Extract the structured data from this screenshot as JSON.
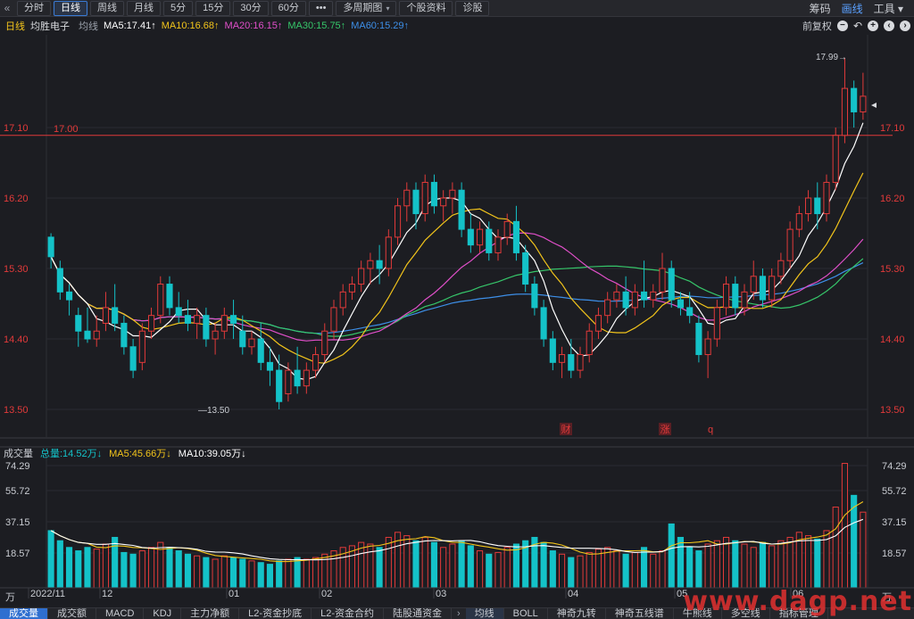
{
  "toolbar": {
    "back_icon": "«",
    "buttons": [
      "分时",
      "日线",
      "周线",
      "月线",
      "5分",
      "15分",
      "30分",
      "60分",
      "•••",
      "多周期图",
      "个股资料",
      "诊股"
    ],
    "active_index": 1,
    "right": [
      "筹码",
      "画线",
      "工具"
    ]
  },
  "info": {
    "period": "日线",
    "name": "均胜电子",
    "line_type": "均线",
    "ma5": "MA5:17.41↑",
    "ma10": "MA10:16.68↑",
    "ma20": "MA20:16.15↑",
    "ma30": "MA30:15.75↑",
    "ma60": "MA60:15.29↑",
    "adjust": "前复权"
  },
  "price_axis": [
    "17.10",
    "16.20",
    "15.30",
    "14.40",
    "13.50"
  ],
  "price_line_label": "17.00",
  "high_label": "17.99→",
  "low_label": "—13.50",
  "markers": [
    "财",
    "涨",
    "q"
  ],
  "volume_info": {
    "label": "成交量",
    "total": "总量:14.52万↓",
    "ma5": "MA5:45.66万↓",
    "ma10": "MA10:39.05万↓"
  },
  "volume_axis": [
    "74.29",
    "55.72",
    "37.15",
    "18.57",
    "万"
  ],
  "dates": [
    "2022/11",
    "12",
    "01",
    "02",
    "03",
    "04",
    "05",
    "06"
  ],
  "tabs": [
    "成交量",
    "成交额",
    "MACD",
    "KDJ",
    "主力净额",
    "L2-资金抄底",
    "L2-资金合约",
    "陆股通资金",
    "均线",
    "BOLL",
    "神奇九转",
    "神奇五线谱",
    "牛熊线",
    "多空线",
    "指标管理"
  ],
  "tabs_active": 0,
  "tabs_blue": 8,
  "tabs_nav": "›",
  "watermark": "www.dagp.net",
  "colors": {
    "up": "#e23a3a",
    "down": "#14c2c8",
    "ma5": "#ffffff",
    "ma10": "#f2c41b",
    "ma20": "#e04fc9",
    "ma30": "#36c66a",
    "ma60": "#3d8fe8",
    "price_line": "#e03a3a"
  },
  "chart_data": {
    "type": "candlestick",
    "title": "均胜电子 日线",
    "ylim": [
      13.5,
      17.99
    ],
    "ma_values": {
      "MA5": 17.41,
      "MA10": 16.68,
      "MA20": 16.15,
      "MA30": 15.75,
      "MA60": 15.29
    },
    "candles": [
      [
        15.7,
        15.75,
        15.45,
        15.3
      ],
      [
        15.3,
        15.4,
        15.0,
        14.9
      ],
      [
        15.0,
        15.1,
        14.9,
        14.7
      ],
      [
        14.7,
        14.8,
        14.5,
        14.3
      ],
      [
        14.5,
        14.8,
        14.4,
        14.35
      ],
      [
        14.4,
        14.7,
        14.5,
        14.3
      ],
      [
        14.6,
        15.0,
        14.8,
        14.5
      ],
      [
        14.8,
        15.1,
        14.6,
        14.5
      ],
      [
        14.6,
        14.7,
        14.3,
        14.2
      ],
      [
        14.3,
        14.4,
        14.0,
        13.9
      ],
      [
        14.1,
        14.6,
        14.5,
        14.0
      ],
      [
        14.5,
        14.8,
        14.7,
        14.4
      ],
      [
        14.7,
        15.2,
        15.1,
        14.6
      ],
      [
        15.1,
        15.2,
        14.8,
        14.7
      ],
      [
        14.8,
        15.0,
        14.7,
        14.6
      ],
      [
        14.7,
        14.9,
        14.6,
        14.5
      ],
      [
        14.6,
        14.8,
        14.7,
        14.4
      ],
      [
        14.7,
        14.8,
        14.4,
        14.3
      ],
      [
        14.4,
        14.6,
        14.5,
        14.2
      ],
      [
        14.5,
        14.8,
        14.7,
        14.4
      ],
      [
        14.7,
        14.9,
        14.6,
        14.4
      ],
      [
        14.5,
        14.7,
        14.3,
        14.2
      ],
      [
        14.3,
        14.5,
        14.4,
        14.2
      ],
      [
        14.4,
        14.6,
        14.1,
        14.0
      ],
      [
        14.1,
        14.3,
        14.0,
        13.8
      ],
      [
        14.0,
        14.2,
        13.6,
        13.5
      ],
      [
        13.7,
        14.1,
        14.0,
        13.6
      ],
      [
        14.0,
        14.3,
        13.8,
        13.7
      ],
      [
        13.8,
        14.1,
        14.0,
        13.7
      ],
      [
        14.0,
        14.3,
        14.2,
        13.9
      ],
      [
        14.2,
        14.6,
        14.5,
        14.1
      ],
      [
        14.5,
        14.9,
        14.8,
        14.4
      ],
      [
        14.8,
        15.1,
        15.0,
        14.7
      ],
      [
        15.0,
        15.2,
        15.1,
        14.9
      ],
      [
        15.1,
        15.4,
        15.3,
        15.0
      ],
      [
        15.3,
        15.5,
        15.4,
        15.1
      ],
      [
        15.4,
        15.6,
        15.3,
        15.1
      ],
      [
        15.3,
        15.8,
        15.7,
        15.2
      ],
      [
        15.7,
        16.2,
        16.1,
        15.6
      ],
      [
        16.1,
        16.4,
        16.3,
        15.9
      ],
      [
        16.3,
        16.4,
        16.0,
        15.8
      ],
      [
        16.0,
        16.5,
        16.4,
        15.9
      ],
      [
        16.4,
        16.5,
        16.1,
        16.0
      ],
      [
        16.1,
        16.3,
        16.2,
        15.9
      ],
      [
        16.2,
        16.4,
        16.3,
        16.0
      ],
      [
        16.3,
        16.4,
        15.8,
        15.7
      ],
      [
        15.8,
        16.0,
        15.6,
        15.5
      ],
      [
        15.6,
        15.9,
        15.8,
        15.5
      ],
      [
        15.8,
        15.9,
        15.5,
        15.4
      ],
      [
        15.5,
        15.8,
        15.7,
        15.4
      ],
      [
        15.7,
        16.0,
        15.9,
        15.6
      ],
      [
        15.9,
        16.1,
        15.5,
        15.4
      ],
      [
        15.5,
        15.6,
        15.1,
        15.0
      ],
      [
        15.1,
        15.2,
        14.8,
        14.7
      ],
      [
        14.8,
        14.9,
        14.4,
        14.3
      ],
      [
        14.4,
        14.5,
        14.1,
        14.0
      ],
      [
        14.1,
        14.3,
        14.2,
        13.9
      ],
      [
        14.2,
        14.4,
        14.0,
        13.9
      ],
      [
        14.0,
        14.3,
        14.2,
        13.9
      ],
      [
        14.2,
        14.6,
        14.5,
        14.1
      ],
      [
        14.5,
        14.8,
        14.7,
        14.4
      ],
      [
        14.7,
        15.0,
        14.9,
        14.6
      ],
      [
        14.9,
        15.1,
        15.0,
        14.8
      ],
      [
        15.0,
        15.2,
        14.8,
        14.7
      ],
      [
        14.8,
        15.1,
        15.0,
        14.7
      ],
      [
        15.0,
        15.4,
        14.9,
        14.8
      ],
      [
        14.9,
        15.1,
        15.0,
        14.8
      ],
      [
        15.0,
        15.5,
        15.3,
        14.9
      ],
      [
        15.3,
        15.4,
        14.9,
        14.8
      ],
      [
        14.9,
        15.0,
        14.8,
        14.7
      ],
      [
        14.8,
        15.0,
        14.7,
        14.6
      ],
      [
        14.6,
        14.7,
        14.2,
        14.1
      ],
      [
        14.2,
        14.5,
        14.4,
        13.9
      ],
      [
        14.4,
        14.9,
        14.8,
        14.3
      ],
      [
        14.8,
        15.2,
        15.1,
        14.7
      ],
      [
        15.1,
        15.2,
        14.8,
        14.7
      ],
      [
        14.8,
        15.1,
        15.0,
        14.7
      ],
      [
        15.0,
        15.4,
        15.2,
        14.9
      ],
      [
        15.2,
        15.3,
        14.9,
        14.8
      ],
      [
        14.9,
        15.3,
        15.2,
        14.8
      ],
      [
        15.2,
        15.5,
        15.4,
        15.1
      ],
      [
        15.4,
        15.9,
        15.8,
        15.3
      ],
      [
        15.8,
        16.1,
        16.0,
        15.7
      ],
      [
        16.0,
        16.3,
        16.2,
        15.9
      ],
      [
        16.2,
        16.4,
        16.0,
        15.8
      ],
      [
        16.0,
        16.5,
        16.4,
        15.9
      ],
      [
        16.4,
        17.1,
        17.0,
        16.3
      ],
      [
        17.0,
        17.99,
        17.6,
        16.9
      ],
      [
        17.6,
        17.7,
        17.3,
        17.1
      ],
      [
        17.3,
        17.8,
        17.5,
        17.2
      ]
    ],
    "volume": [
      34,
      28,
      24,
      22,
      24,
      23,
      26,
      30,
      21,
      20,
      22,
      24,
      27,
      24,
      22,
      20,
      19,
      18,
      17,
      19,
      18,
      17,
      16,
      15,
      14,
      16,
      17,
      18,
      17,
      18,
      20,
      22,
      24,
      25,
      27,
      26,
      24,
      30,
      33,
      31,
      28,
      30,
      27,
      24,
      26,
      28,
      25,
      22,
      20,
      21,
      24,
      26,
      28,
      30,
      27,
      22,
      20,
      18,
      19,
      21,
      23,
      24,
      22,
      20,
      21,
      24,
      20,
      22,
      38,
      30,
      24,
      22,
      26,
      28,
      30,
      28,
      26,
      24,
      27,
      25,
      28,
      30,
      33,
      31,
      29,
      34,
      48,
      74,
      55,
      45
    ],
    "volume_ylim": [
      0,
      74.29
    ]
  }
}
